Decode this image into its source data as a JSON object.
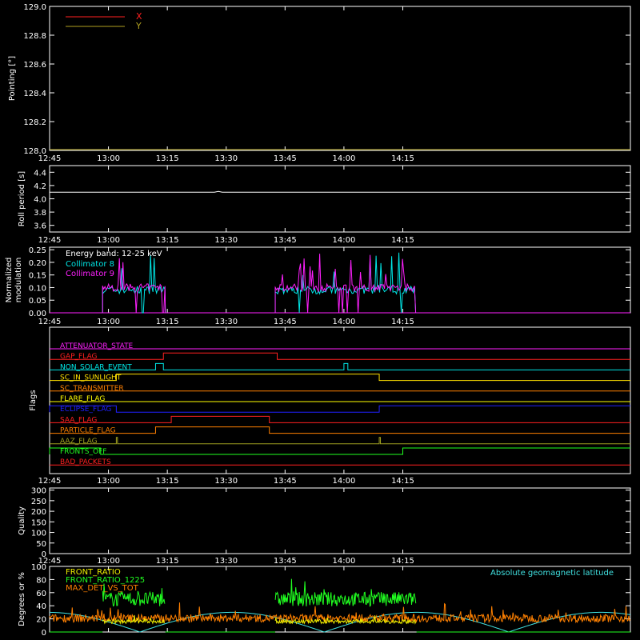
{
  "colors": {
    "background": "#000000",
    "axis": "#ffffff",
    "x_series": "#ff2020",
    "y_series": "#b0a020",
    "roll": "#ffffff",
    "c8": "#00e8e8",
    "c9": "#ff20ff",
    "front_ratio": "#f0f000",
    "front_ratio_1225": "#20ff20",
    "max_det": "#ff8000",
    "geomag": "#40e0e0"
  },
  "time_ticks": [
    "12:45",
    "13:00",
    "13:15",
    "13:30",
    "13:45",
    "14:00",
    "14:15"
  ],
  "time_range": [
    -15,
    133
  ],
  "panels": {
    "pointing": {
      "ylabel": "Pointing [°]",
      "ticks": [
        "128.0",
        "128.2",
        "128.4",
        "128.6",
        "128.8",
        "129.0"
      ],
      "ylim": [
        128.0,
        129.0
      ],
      "legend": [
        {
          "label": "X",
          "color": "#ff2020"
        },
        {
          "label": "Y",
          "color": "#b0a020"
        }
      ]
    },
    "roll": {
      "ylabel": "Roll period [s]",
      "ticks": [
        "3.6",
        "3.8",
        "4.0",
        "4.2",
        "4.4"
      ],
      "ylim": [
        3.5,
        4.5
      ],
      "value": 4.1
    },
    "modulation": {
      "ylabel_line1": "Normalized",
      "ylabel_line2": "modulation",
      "ticks": [
        "0.00",
        "0.05",
        "0.10",
        "0.15",
        "0.20",
        "0.25"
      ],
      "ylim": [
        0.0,
        0.26
      ],
      "energy_band": "Energy band: 12-25 keV",
      "legend": [
        {
          "label": "Collimator 8",
          "color": "#00e8e8"
        },
        {
          "label": "Collimator 9",
          "color": "#ff20ff"
        }
      ],
      "active_intervals": [
        [
          -1.5,
          14.5
        ],
        [
          42.5,
          78.5
        ]
      ]
    },
    "flags": {
      "ylabel": "Flags",
      "rows": [
        {
          "name": "ATTENUATOR_STATE",
          "color": "#ff20ff",
          "high": []
        },
        {
          "name": "GAP_FLAG",
          "color": "#ff2020",
          "high": [
            [
              14,
              43
            ]
          ]
        },
        {
          "name": "NON_SOLAR_EVENT",
          "color": "#00e8e8",
          "high": [
            [
              12,
              14
            ],
            [
              60,
              61
            ]
          ]
        },
        {
          "name": "SC_IN_SUNLIGHT",
          "color": "#ffe000",
          "high": [
            [
              2,
              69
            ]
          ]
        },
        {
          "name": "SC_TRANSMITTER",
          "color": "#ff8000",
          "high": []
        },
        {
          "name": "FLARE_FLAG",
          "color": "#ffff00",
          "high": []
        },
        {
          "name": "ECLIPSE_FLAG",
          "color": "#2020ff",
          "high": [
            [
              -150,
              2
            ],
            [
              69,
              300
            ]
          ]
        },
        {
          "name": "SAA_FLAG",
          "color": "#ff2020",
          "high": [
            [
              16,
              41
            ]
          ]
        },
        {
          "name": "PARTICLE_FLAG",
          "color": "#ff8000",
          "high": [
            [
              12,
              41
            ]
          ]
        },
        {
          "name": "AAZ_FLAG",
          "color": "#a0a020",
          "high": [
            [
              2,
              2.3
            ],
            [
              69,
              69.3
            ]
          ]
        },
        {
          "name": "FRONTS_OFF",
          "color": "#20ff20",
          "high": [
            [
              -150,
              -2
            ],
            [
              75,
              300
            ]
          ]
        },
        {
          "name": "BAD_PACKETS",
          "color": "#ff2020",
          "high": []
        }
      ]
    },
    "quality": {
      "ylabel": "Quality",
      "ticks": [
        "0",
        "50",
        "100",
        "150",
        "200",
        "250",
        "300"
      ],
      "ylim": [
        0,
        310
      ]
    },
    "ratios": {
      "ylabel": "Degrees or %",
      "ticks": [
        "0",
        "20",
        "40",
        "60",
        "80",
        "100"
      ],
      "ylim": [
        0,
        100
      ],
      "legend": [
        {
          "label": "FRONT_RATIO",
          "color": "#f0f000"
        },
        {
          "label": "FRONT_RATIO_1225",
          "color": "#20ff20"
        },
        {
          "label": "MAX_DET_VS_TOT",
          "color": "#ff8000"
        }
      ],
      "geomag_label": "Absolute geomagnetic latitude"
    }
  },
  "chart_data": {
    "type": "line",
    "x_unit": "minutes after 13:00 UT",
    "series": [
      {
        "name": "X",
        "panel": "pointing",
        "value": 128.0
      },
      {
        "name": "Y",
        "panel": "pointing",
        "value": 128.0
      },
      {
        "name": "Roll period",
        "panel": "roll",
        "value": 4.1
      },
      {
        "name": "Collimator 8",
        "panel": "modulation",
        "typical": 0.09,
        "max": 0.22
      },
      {
        "name": "Collimator 9",
        "panel": "modulation",
        "typical": 0.1,
        "max": 0.25
      },
      {
        "name": "FRONT_RATIO_1225",
        "panel": "ratios",
        "typical": 55,
        "max": 75
      },
      {
        "name": "MAX_DET_VS_TOT",
        "panel": "ratios",
        "typical": 20,
        "max": 40
      },
      {
        "name": "Absolute geomagnetic latitude",
        "panel": "ratios",
        "range": [
          0,
          30
        ]
      }
    ]
  }
}
